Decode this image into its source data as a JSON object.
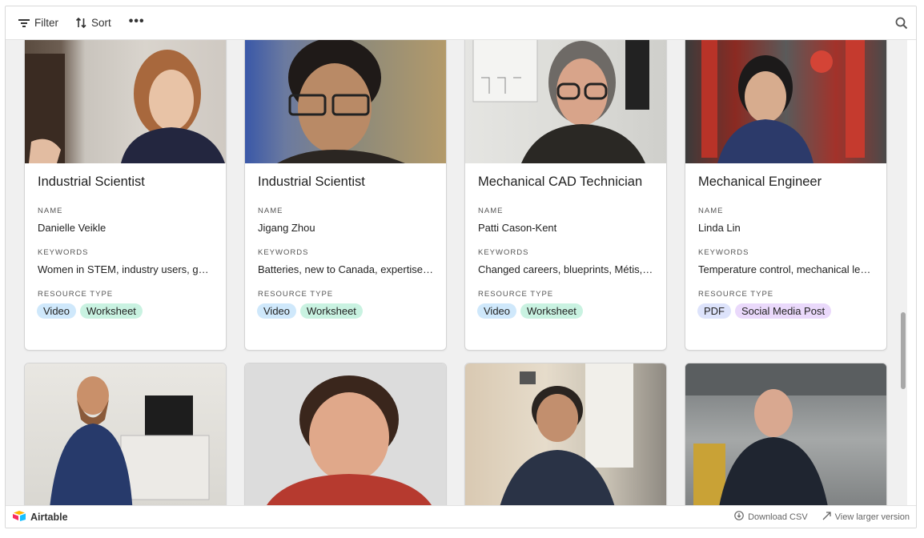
{
  "toolbar": {
    "filter_label": "Filter",
    "sort_label": "Sort",
    "more_label": "•••"
  },
  "labels": {
    "name": "NAME",
    "keywords": "KEYWORDS",
    "resource_type": "RESOURCE TYPE"
  },
  "cards": [
    {
      "title": "Industrial Scientist",
      "name": "Danielle Veikle",
      "keywords": "Women in STEM, industry users, geo...",
      "tags": [
        "Video",
        "Worksheet"
      ]
    },
    {
      "title": "Industrial Scientist",
      "name": "Jigang Zhou",
      "keywords": "Batteries, new to Canada, expertise, ...",
      "tags": [
        "Video",
        "Worksheet"
      ]
    },
    {
      "title": "Mechanical CAD Technician",
      "name": "Patti Cason-Kent",
      "keywords": "Changed careers, blueprints, Métis, ...",
      "tags": [
        "Video",
        "Worksheet"
      ]
    },
    {
      "title": "Mechanical Engineer",
      "name": "Linda Lin",
      "keywords": "Temperature control, mechanical lea...",
      "tags": [
        "PDF",
        "Social Media Post"
      ]
    }
  ],
  "tag_colors": {
    "Video": "#cfe8fb",
    "Worksheet": "#c9f2e1",
    "PDF": "#dde3fb",
    "Social Media Post": "#ead9fb"
  },
  "footer": {
    "brand": "Airtable",
    "download_csv": "Download CSV",
    "view_larger": "View larger version"
  }
}
